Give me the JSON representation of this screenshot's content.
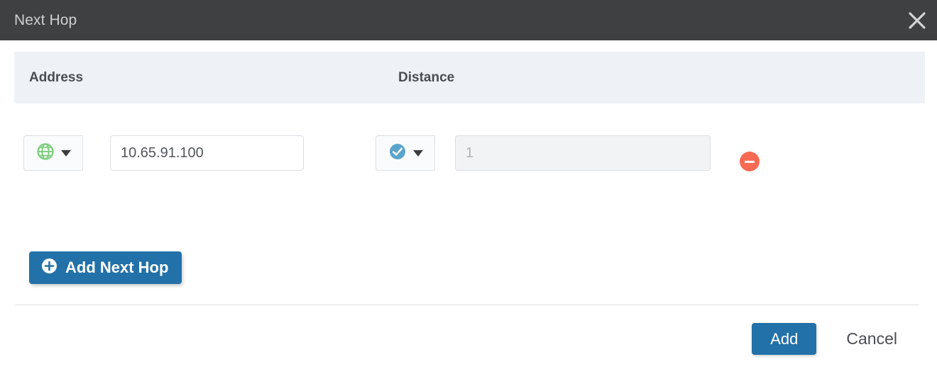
{
  "dialog": {
    "title": "Next Hop",
    "close_icon": "close-icon"
  },
  "table": {
    "columns": [
      {
        "label": "Address"
      },
      {
        "label": "Distance"
      }
    ],
    "rows": [
      {
        "address": {
          "type_icon": "globe-icon",
          "type_icon_color": "#7fce80",
          "dropdown_icon": "chevron-down-icon",
          "value": "10.65.91.100",
          "placeholder": ""
        },
        "distance": {
          "type_icon": "check-circle-icon",
          "type_icon_color": "#58a4cc",
          "dropdown_icon": "chevron-down-icon",
          "value": "",
          "placeholder": "1",
          "disabled": true
        },
        "remove_icon": "minus-circle-icon",
        "remove_color": "#f96a55"
      }
    ]
  },
  "actions": {
    "add_next_hop_label": "Add Next Hop",
    "add_next_hop_icon": "plus-circle-icon",
    "add_label": "Add",
    "cancel_label": "Cancel"
  },
  "colors": {
    "titlebar_bg": "#3e4042",
    "table_header_bg": "#eef1f6",
    "primary": "#2271a8",
    "danger": "#f96a55"
  }
}
